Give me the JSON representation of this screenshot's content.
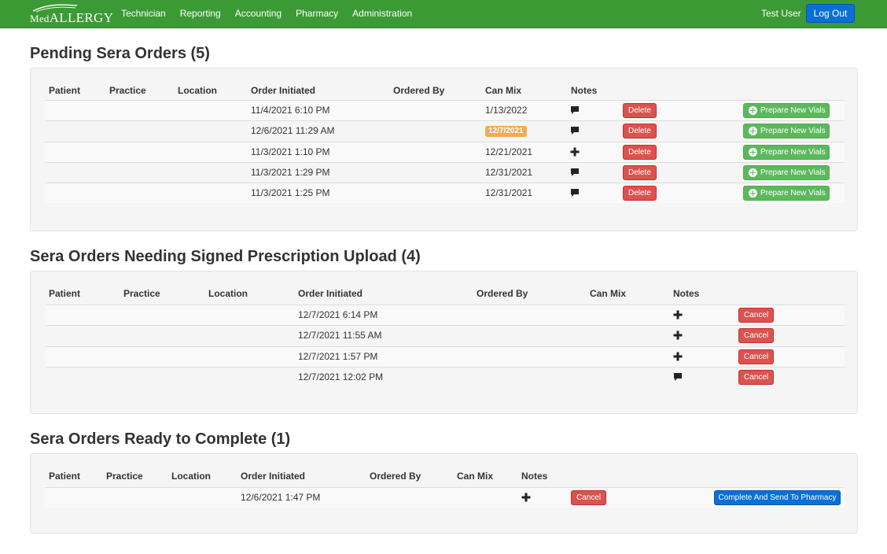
{
  "app": {
    "brand_prefix": "Med",
    "brand_name": "Allergy",
    "nav": [
      "Technician",
      "Reporting",
      "Accounting",
      "Pharmacy",
      "Administration"
    ],
    "user": "Test User",
    "logout": "Log Out"
  },
  "colors": {
    "navbar": "#3c9a35",
    "primary": "#0a6fd6",
    "danger": "#d9534f",
    "success": "#5cb85c",
    "warning": "#f0ad4e"
  },
  "pending": {
    "title": "Pending Sera Orders (5)",
    "headers": [
      "Patient",
      "Practice",
      "Location",
      "Order Initiated",
      "Ordered By",
      "Can Mix",
      "Notes"
    ],
    "delete_label": "Delete",
    "prepare_label": "Prepare New Vials",
    "rows": [
      {
        "initiated": "11/4/2021 6:10 PM",
        "can_mix": "1/13/2022",
        "can_mix_highlight": false,
        "notes_icon": "comment-icon"
      },
      {
        "initiated": "12/6/2021 11:29 AM",
        "can_mix": "12/7/2021",
        "can_mix_highlight": true,
        "notes_icon": "comment-icon"
      },
      {
        "initiated": "11/3/2021 1:10 PM",
        "can_mix": "12/21/2021",
        "can_mix_highlight": false,
        "notes_icon": "plus-icon"
      },
      {
        "initiated": "11/3/2021 1:29 PM",
        "can_mix": "12/31/2021",
        "can_mix_highlight": false,
        "notes_icon": "comment-icon"
      },
      {
        "initiated": "11/3/2021 1:25 PM",
        "can_mix": "12/31/2021",
        "can_mix_highlight": false,
        "notes_icon": "comment-icon"
      }
    ]
  },
  "needing": {
    "title": "Sera Orders Needing Signed Prescription Upload (4)",
    "headers": [
      "Patient",
      "Practice",
      "Location",
      "Order Initiated",
      "Ordered By",
      "Can Mix",
      "Notes"
    ],
    "cancel_label": "Cancel",
    "rows": [
      {
        "initiated": "12/7/2021 6:14 PM",
        "notes_icon": "plus-icon"
      },
      {
        "initiated": "12/7/2021 11:55 AM",
        "notes_icon": "plus-icon"
      },
      {
        "initiated": "12/7/2021 1:57 PM",
        "notes_icon": "plus-icon"
      },
      {
        "initiated": "12/7/2021 12:02 PM",
        "notes_icon": "comment-icon"
      }
    ]
  },
  "ready": {
    "title": "Sera Orders Ready to Complete (1)",
    "headers": [
      "Patient",
      "Practice",
      "Location",
      "Order Initiated",
      "Ordered By",
      "Can Mix",
      "Notes"
    ],
    "cancel_label": "Cancel",
    "complete_label": "Complete And Send To Pharmacy",
    "rows": [
      {
        "initiated": "12/6/2021 1:47 PM",
        "notes_icon": "plus-icon"
      }
    ]
  }
}
